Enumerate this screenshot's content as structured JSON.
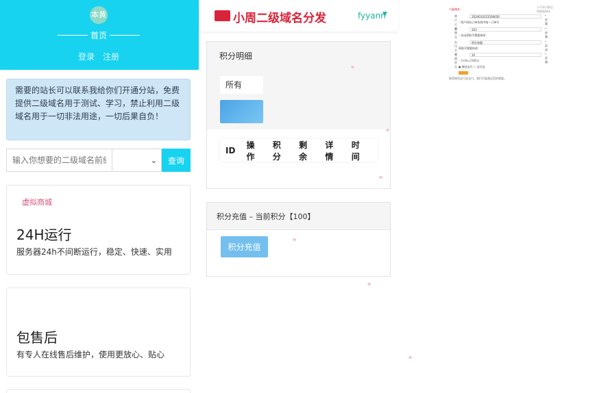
{
  "left": {
    "avatar_text": "本黄",
    "home_title": "首页",
    "login": "登录",
    "register": "注册",
    "notice": "需要的站长可以联系我给你们开通分站，免费提供二级域名用于测试、学习，禁止利用二级域名用于一切非法用途，一切后果自负！",
    "search_placeholder": "输入你想要的二级域名前缀",
    "search_button": "查询",
    "cards": [
      {
        "logo": "虚拟商城",
        "title": "24H运行",
        "desc": "服务器24h不间断运行，稳定、快速、实用"
      },
      {
        "logo": "",
        "title": "包售后",
        "desc": "有专人在线售后维护，使用更放心、贴心"
      }
    ]
  },
  "middle": {
    "brand": "小周二级域名分发",
    "user": "fyyann",
    "points_panel_title": "积分明细",
    "filter_value": "所有",
    "table_headers": [
      "ID",
      "操作",
      "积分",
      "剩余",
      "详情",
      "时间"
    ],
    "recharge_panel_title": "积分充值 – 当前积分【100】",
    "recharge_button": "积分充值"
  },
  "thumb": {
    "title": "小汽车付款后的链接测试",
    "logo": "二级域名",
    "rows": [
      {
        "label": "商户订单号",
        "value": "2024010223506656",
        "note": "*必填"
      },
      {
        "label": "商户号",
        "value": "101",
        "note": "*必填"
      },
      {
        "label": "支付方式",
        "value": "积分充值",
        "note": "*自动"
      },
      {
        "label": "充值积分",
        "value": "10",
        "note": "*必填"
      }
    ],
    "hints": [
      "– 商户网站订单系统中唯一订单号",
      "– 自动获取不需要修改",
      "获取不需要修改",
      "– 1rmb=50积分",
      "● 微信支付 ○ 支付宝"
    ],
    "footer": "推荐使用支付宝支付，我们尽量满足您的需要。"
  }
}
